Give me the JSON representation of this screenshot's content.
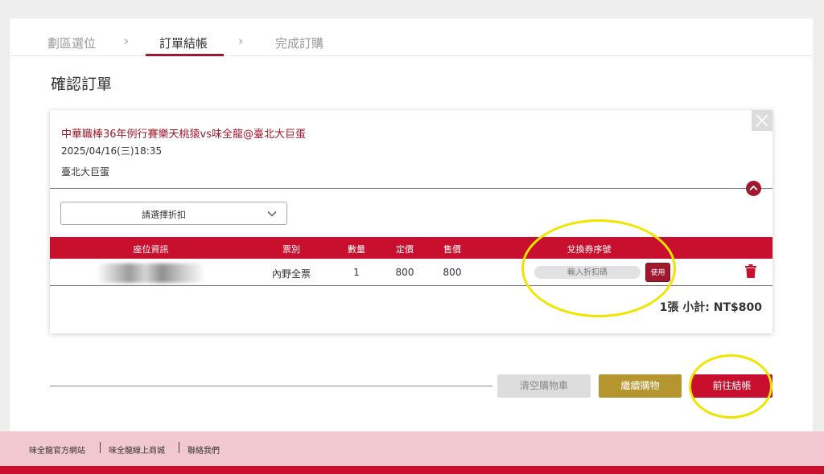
{
  "steps": [
    {
      "label": "劃區選位"
    },
    {
      "label": "訂單結帳"
    },
    {
      "label": "完成訂購"
    }
  ],
  "step_separator": "›",
  "page_title": "確認訂單",
  "event": {
    "title": "中華職棒36年例行賽樂天桃猿vs味全龍@臺北大巨蛋",
    "datetime": "2025/04/16(三)18:35",
    "venue": "臺北大巨蛋"
  },
  "discount_select": {
    "placeholder": "請選擇折扣"
  },
  "table": {
    "headers": [
      "座位資訊",
      "票別",
      "數量",
      "定價",
      "售價",
      "兌換券序號"
    ],
    "rows": [
      {
        "seat": "",
        "ticket_type": "內野全票",
        "quantity": "1",
        "list_price": "800",
        "sale_price": "800"
      }
    ],
    "coupon_placeholder": "輸入折扣碼",
    "use_label": "使用"
  },
  "subtotal": "1張 小計: NT$800",
  "buttons": {
    "clear_cart": "清空購物車",
    "continue_shopping": "繼續購物",
    "checkout": "前往結帳"
  },
  "footer": {
    "links": [
      "味全龍官方網站",
      "味全龍線上商城",
      "聯絡我們"
    ]
  },
  "colors": {
    "brand_red": "#c8102e",
    "dark_red": "#a0182e",
    "gold": "#b5952f",
    "annotation_yellow": "#f0e500",
    "footer_pink": "#f1c8d0"
  }
}
